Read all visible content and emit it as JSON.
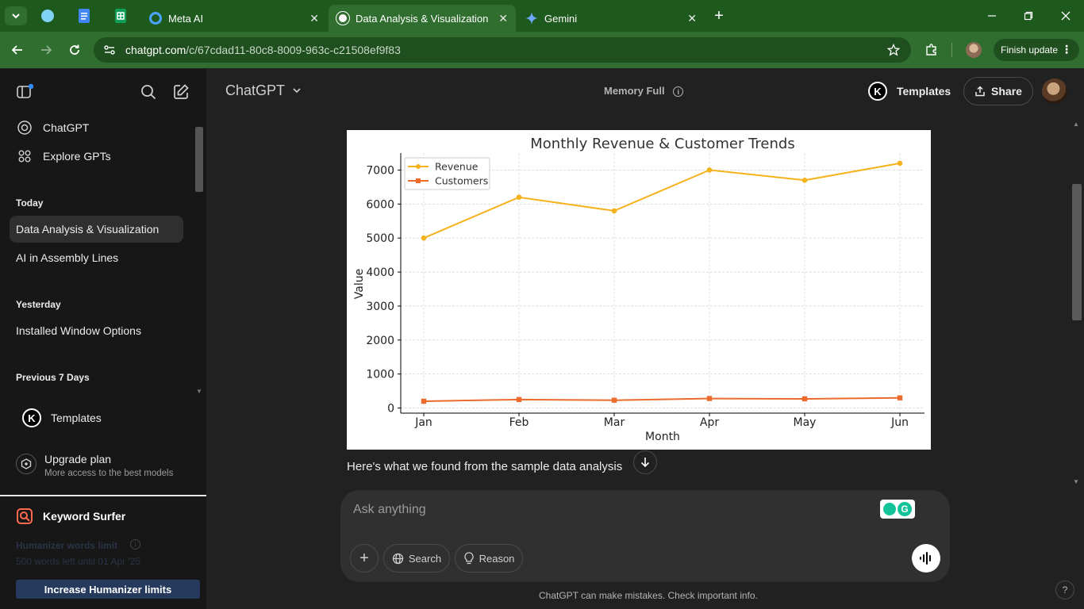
{
  "browser": {
    "tabs": [
      {
        "title": "Meta AI"
      },
      {
        "title": "Data Analysis & Visualization"
      },
      {
        "title": "Gemini"
      }
    ],
    "new_tab": "+",
    "close": "✕",
    "url_domain": "chatgpt.com",
    "url_path": "/c/67cdad11-80c8-8009-963c-c21508ef9f83",
    "finish_update": "Finish update"
  },
  "sidebar": {
    "top_items": [
      {
        "label": "ChatGPT"
      },
      {
        "label": "Explore GPTs"
      }
    ],
    "sections": {
      "today": "Today",
      "yesterday": "Yesterday",
      "previous7": "Previous 7 Days"
    },
    "chats": {
      "today": [
        "Data Analysis & Visualization",
        "AI in Assembly Lines"
      ],
      "yesterday": [
        "Installed Window Options"
      ]
    },
    "templates": "Templates",
    "upgrade": {
      "title": "Upgrade plan",
      "subtitle": "More access to the best models"
    },
    "keyword_surfer": "Keyword Surfer",
    "humanizer": {
      "limit": "Humanizer words limit",
      "left": "500 words left until 01 Apr '25",
      "button": "Increase Humanizer limits"
    }
  },
  "header": {
    "brand": "ChatGPT",
    "memory": "Memory Full",
    "templates": "Templates",
    "k_letter": "K",
    "share": "Share"
  },
  "chart_data": {
    "type": "line",
    "title": "Monthly Revenue & Customer Trends",
    "xlabel": "Month",
    "ylabel": "Value",
    "categories": [
      "Jan",
      "Feb",
      "Mar",
      "Apr",
      "May",
      "Jun"
    ],
    "series": [
      {
        "name": "Revenue",
        "values": [
          5000,
          6200,
          5800,
          7000,
          6700,
          7200
        ],
        "color": "#f5b21b",
        "marker": "circle"
      },
      {
        "name": "Customers",
        "values": [
          200,
          250,
          230,
          280,
          270,
          300
        ],
        "color": "#ea6b2c",
        "marker": "square"
      }
    ],
    "yticks": [
      0,
      1000,
      2000,
      3000,
      4000,
      5000,
      6000,
      7000
    ],
    "ylim": [
      -150,
      7500
    ],
    "grid": true,
    "legend": "top-left"
  },
  "conversation": {
    "reply": "Here's what we found from the sample data analysis"
  },
  "composer": {
    "placeholder": "Ask anything",
    "search": "Search",
    "reason": "Reason",
    "plus": "+"
  },
  "footer": {
    "disclaimer": "ChatGPT can make mistakes. Check important info.",
    "help": "?"
  },
  "colors": {
    "browser_frame": "#1e5a1e",
    "sidebar_bg": "#171717",
    "main_bg": "#212121"
  }
}
